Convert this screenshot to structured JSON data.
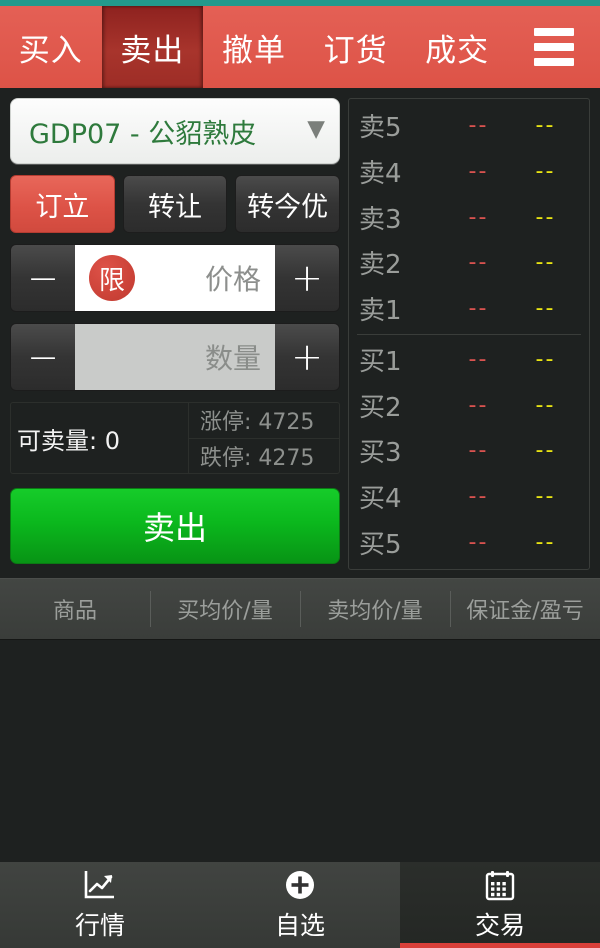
{
  "topbar": {
    "tabs": [
      {
        "label": "买入",
        "active": false
      },
      {
        "label": "卖出",
        "active": true
      },
      {
        "label": "撤单",
        "active": false
      },
      {
        "label": "订货",
        "active": false
      },
      {
        "label": "成交",
        "active": false
      }
    ],
    "menu_icon": "hamburger-icon"
  },
  "order_form": {
    "symbol": "GDP07 - 公貂熟皮",
    "symbol_chevron": "chevron-down-icon",
    "modes": [
      {
        "label": "订立",
        "active": true
      },
      {
        "label": "转让",
        "active": false
      },
      {
        "label": "转今优",
        "active": false
      }
    ],
    "price_row": {
      "minus": "−",
      "plus": "+",
      "badge": "限",
      "value": "",
      "placeholder": "价格"
    },
    "qty_row": {
      "minus": "−",
      "plus": "+",
      "value": "",
      "placeholder": "数量"
    },
    "available": "可卖量: 0",
    "limit_up": "涨停: 4725",
    "limit_down": "跌停: 4275",
    "action_label": "卖出"
  },
  "order_book": {
    "sell": [
      {
        "label": "卖5",
        "price": "--",
        "volume": "--"
      },
      {
        "label": "卖4",
        "price": "--",
        "volume": "--"
      },
      {
        "label": "卖3",
        "price": "--",
        "volume": "--"
      },
      {
        "label": "卖2",
        "price": "--",
        "volume": "--"
      },
      {
        "label": "卖1",
        "price": "--",
        "volume": "--"
      }
    ],
    "buy": [
      {
        "label": "买1",
        "price": "--",
        "volume": "--"
      },
      {
        "label": "买2",
        "price": "--",
        "volume": "--"
      },
      {
        "label": "买3",
        "price": "--",
        "volume": "--"
      },
      {
        "label": "买4",
        "price": "--",
        "volume": "--"
      },
      {
        "label": "买5",
        "price": "--",
        "volume": "--"
      }
    ]
  },
  "positions_header": {
    "columns": [
      "商品",
      "买均价/量",
      "卖均价/量",
      "保证金/盈亏"
    ]
  },
  "positions_rows": [],
  "bottom_nav": {
    "items": [
      {
        "label": "行情",
        "icon": "chart-icon",
        "active": false
      },
      {
        "label": "自选",
        "icon": "plus-circle-icon",
        "active": false
      },
      {
        "label": "交易",
        "icon": "calendar-icon",
        "active": true
      }
    ]
  },
  "colors": {
    "brand_red": "#dd5347",
    "active_tab_red": "#9d2d26",
    "sell_green": "#0bb81d",
    "symbol_green": "#2e7a3c",
    "price_red": "#d9534f",
    "volume_yellow": "#e9e413",
    "accent_teal": "#23998c",
    "background": "#1e2120"
  }
}
